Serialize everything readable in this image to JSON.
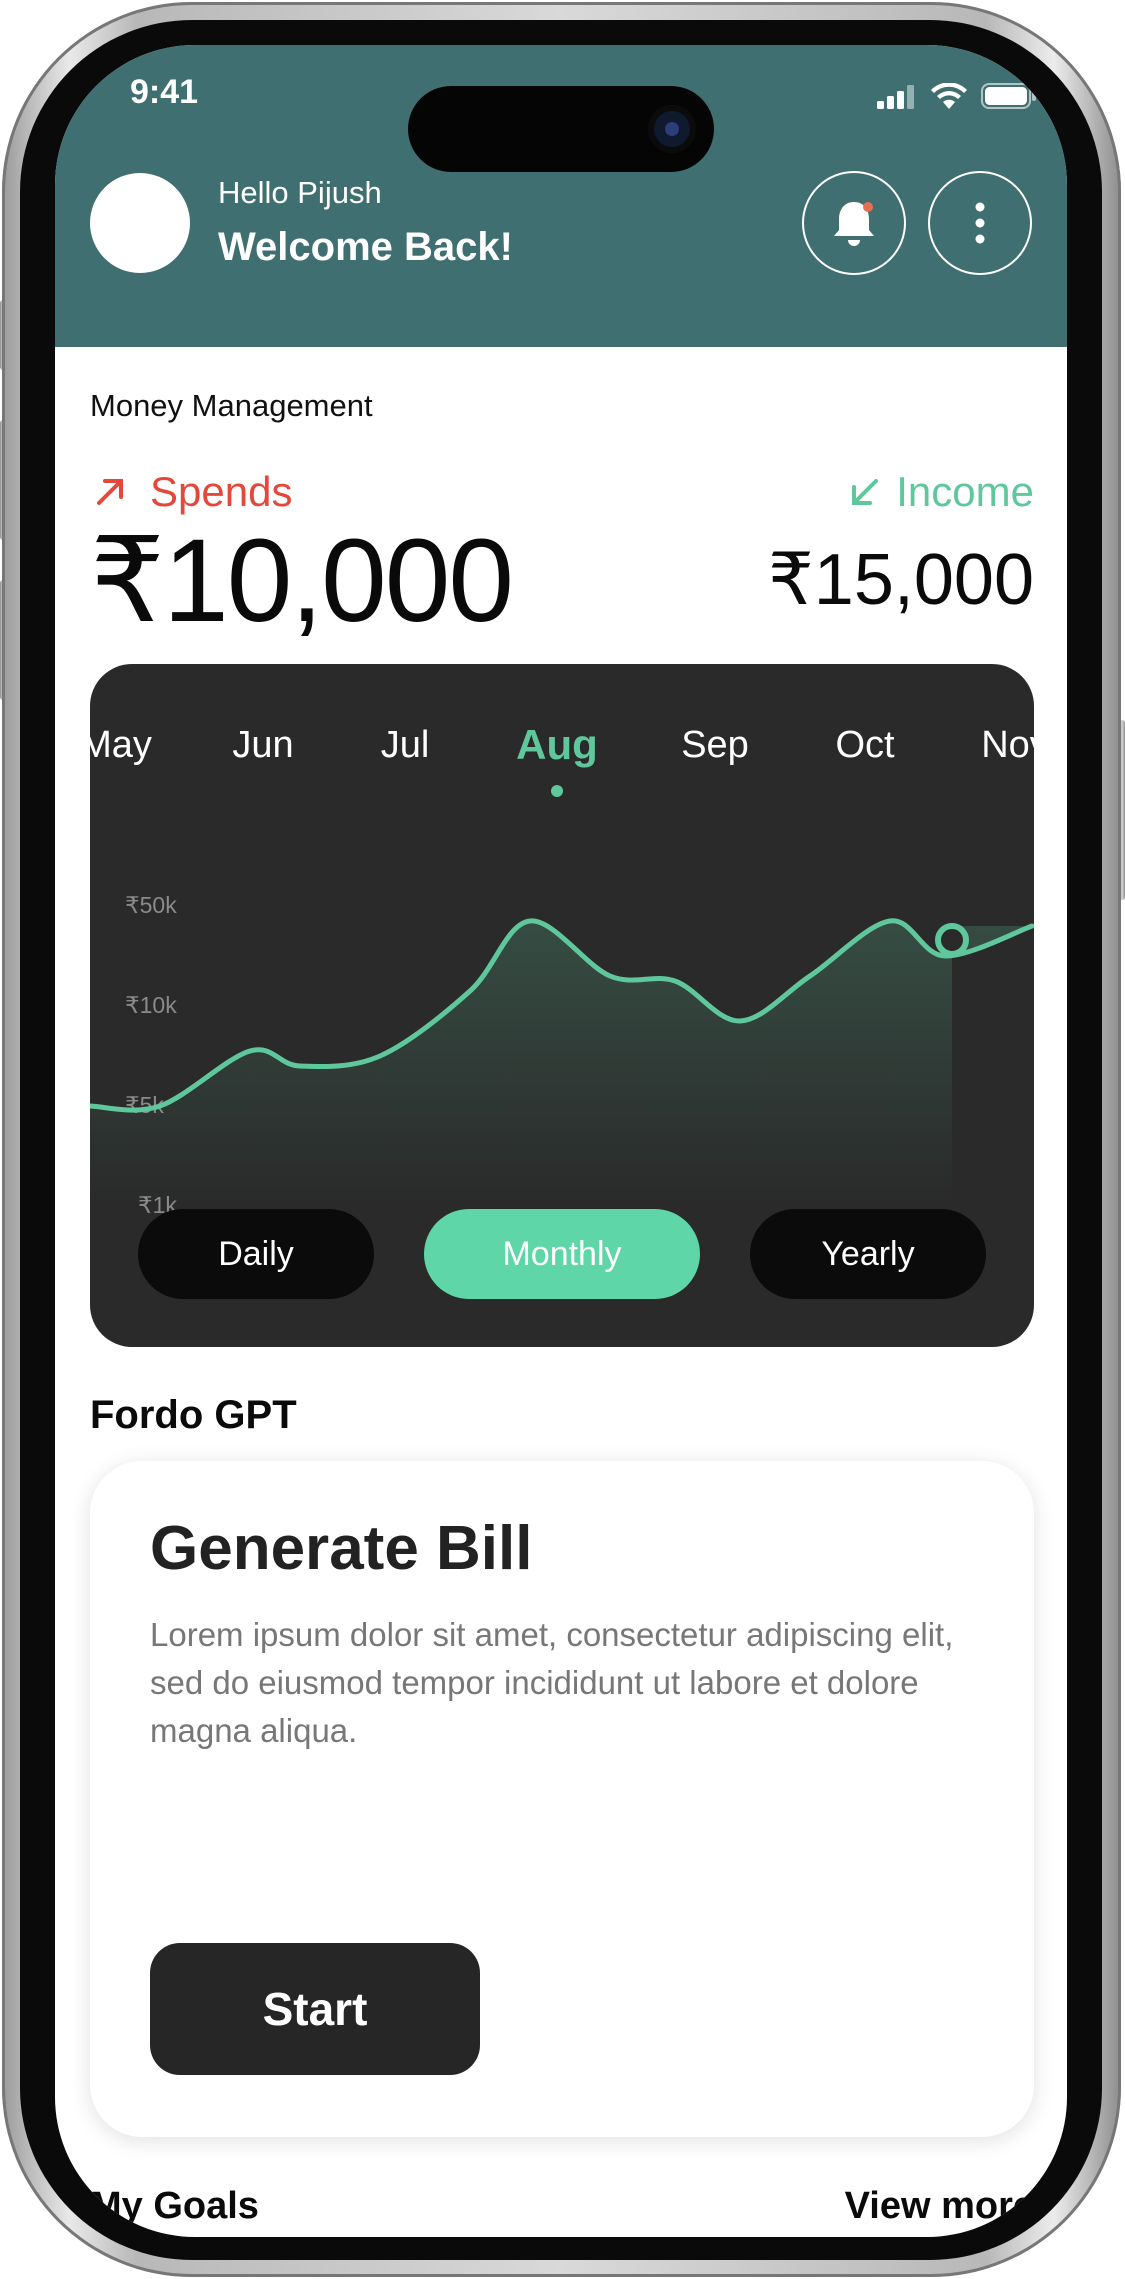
{
  "status_bar": {
    "time": "9:41"
  },
  "header": {
    "greeting": "Hello Pijush",
    "welcome": "Welcome Back!",
    "notification_dot_color": "#e76f51"
  },
  "money": {
    "section_title": "Money Management",
    "spends_label": "Spends",
    "spends_amount": "₹10,000",
    "income_label": "Income",
    "income_amount": "₹15,000",
    "spends_color": "#e5483b",
    "income_color": "#5fc79c"
  },
  "chart_data": {
    "type": "area",
    "months": [
      "May",
      "Jun",
      "Jul",
      "Aug",
      "Sep",
      "Oct",
      "Nov"
    ],
    "selected_month": "Aug",
    "y_ticks": [
      "₹50k",
      "₹10k",
      "₹5k",
      "₹1k"
    ],
    "y_scale": "categorical ticks",
    "series": [
      {
        "values_in_tick_units": [
          2,
          2,
          2.55,
          2.4,
          2.5,
          3.15,
          3.85,
          3.3,
          3.25,
          2.85,
          3.3,
          3.85,
          3.5,
          3.8
        ]
      }
    ],
    "line_color": "#5fc79c",
    "end_marker": true
  },
  "period_toggle": {
    "options": [
      "Daily",
      "Monthly",
      "Yearly"
    ],
    "selected": "Monthly"
  },
  "gpt": {
    "section_title": "Fordo GPT",
    "card_title": "Generate Bill",
    "card_description": "Lorem ipsum dolor sit amet, consectetur adipiscing elit, sed do eiusmod tempor incididunt ut labore et dolore magna aliqua.",
    "start_label": "Start"
  },
  "goals": {
    "section_title": "My Goals",
    "view_more": "View more"
  }
}
